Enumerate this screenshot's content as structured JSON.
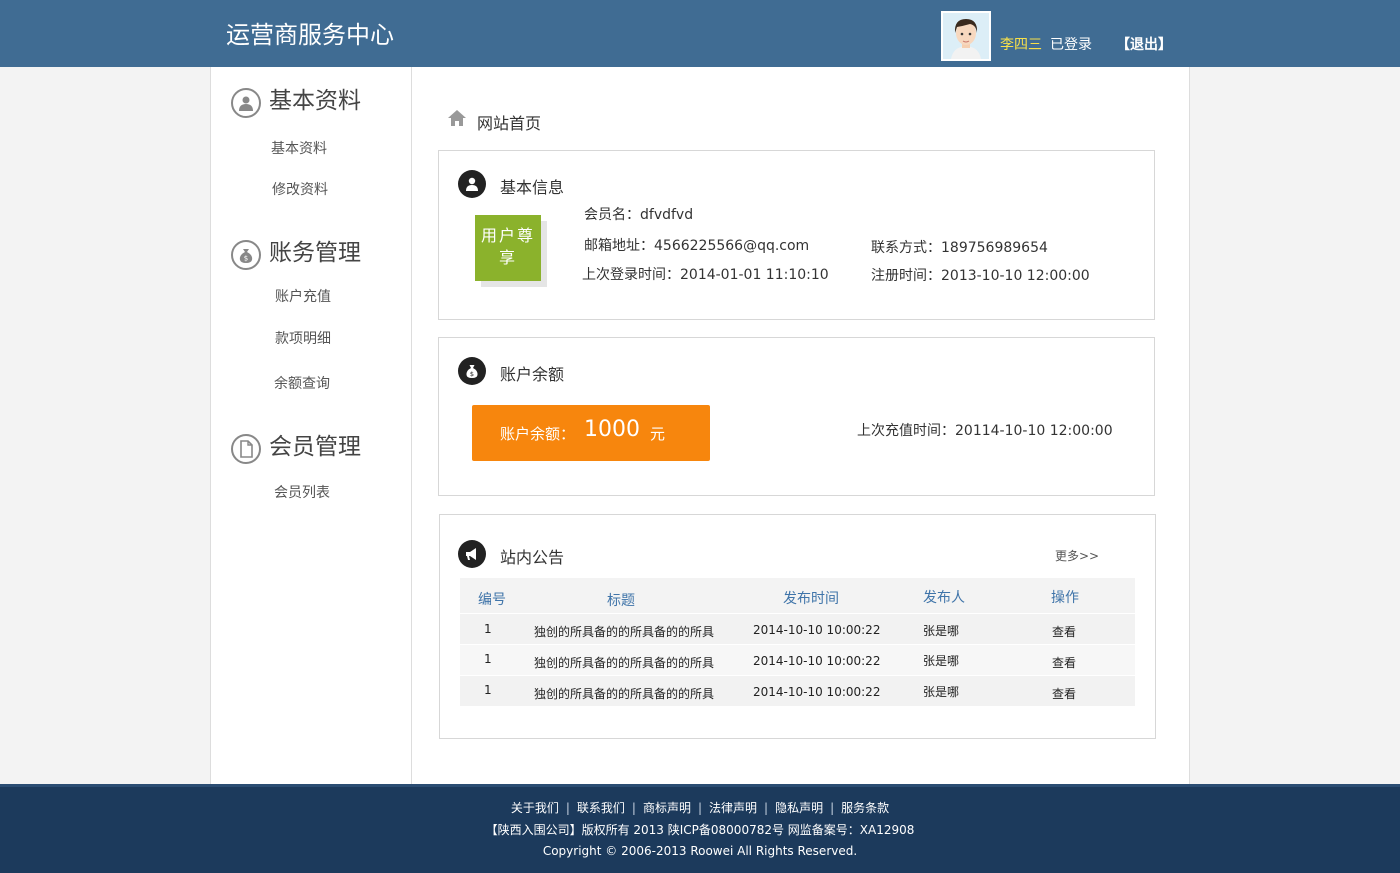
{
  "header": {
    "site_title": "运营商服务中心",
    "user_name": "李四三",
    "login_status": "已登录",
    "logout_label": "【退出】"
  },
  "sidebar": {
    "groups": [
      {
        "title": "基本资料",
        "icon": "user-icon",
        "items": [
          "基本资料",
          "修改资料"
        ]
      },
      {
        "title": "账务管理",
        "icon": "money-bag-icon",
        "items": [
          "账户充值",
          "款项明细",
          "余额查询"
        ]
      },
      {
        "title": "会员管理",
        "icon": "document-icon",
        "items": [
          "会员列表"
        ]
      }
    ]
  },
  "breadcrumb": {
    "icon": "home-icon",
    "label": "网站首页"
  },
  "basic_info": {
    "title": "基本信息",
    "badge": "用户尊享",
    "member_name": "会员名：dfvdfvd",
    "email": "邮箱地址：4566225566@qq.com",
    "contact": "联系方式：189756989654",
    "last_login": "上次登录时间：2014-01-01 11:10:10",
    "register_time": "注册时间：2013-10-10 12:00:00"
  },
  "balance": {
    "title": "账户余额",
    "label": "账户余额：",
    "amount": "1000",
    "unit": "元",
    "last_recharge": "上次充值时间：20114-10-10 12:00:00"
  },
  "notices": {
    "title": "站内公告",
    "more": "更多>>",
    "columns": [
      "编号",
      "标题",
      "发布时间",
      "发布人",
      "操作"
    ],
    "rows": [
      {
        "id": "1",
        "title": "独创的所具备的的所具备的的所具",
        "time": "2014-10-10  10:00:22",
        "author": "张是哪",
        "action": "查看"
      },
      {
        "id": "1",
        "title": "独创的所具备的的所具备的的所具",
        "time": "2014-10-10  10:00:22",
        "author": "张是哪",
        "action": "查看"
      },
      {
        "id": "1",
        "title": "独创的所具备的的所具备的的所具",
        "time": "2014-10-10  10:00:22",
        "author": "张是哪",
        "action": "查看"
      }
    ]
  },
  "footer": {
    "links": [
      "关于我们",
      "联系我们",
      "商标声明",
      "法律声明",
      "隐私声明",
      "服务条款"
    ],
    "copyright_cn": "【陕西入围公司】版权所有 2013  陕ICP备08000782号  网监备案号：XA12908",
    "copyright_en": "Copyright © 2006-2013 Roowei All Rights Reserved."
  },
  "colors": {
    "header": "#406c93",
    "footer": "#1c3a5c",
    "badge": "#8bb22c",
    "balance": "#f7860d",
    "user_name": "#f7e04a",
    "table_header": "#3f74a9"
  }
}
